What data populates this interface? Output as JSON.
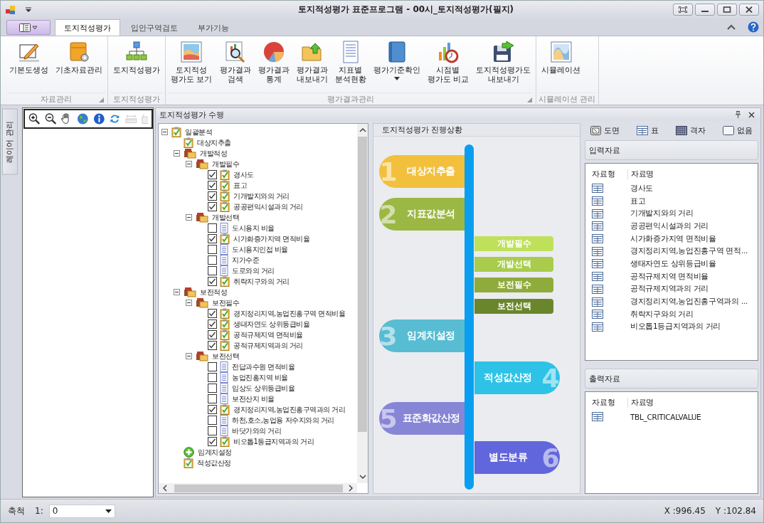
{
  "window": {
    "title": "토지적성평가 표준프로그램 - 00시_토지적성평가(필지)"
  },
  "ribbon": {
    "tabs": [
      {
        "label": "토지적성평가",
        "selected": true
      },
      {
        "label": "입안구역검토",
        "selected": false
      },
      {
        "label": "부가기능",
        "selected": false
      }
    ],
    "groups": [
      {
        "label": "자료관리",
        "launcher": true,
        "buttons": [
          {
            "label": "기본도생성",
            "dropdown": false
          },
          {
            "label": "기초자료관리",
            "dropdown": false
          }
        ]
      },
      {
        "label": "토지적성평가",
        "launcher": false,
        "buttons": [
          {
            "label": "토지적성평가",
            "dropdown": false
          }
        ]
      },
      {
        "label": "평가결과관리",
        "launcher": true,
        "buttons": [
          {
            "label": "토지적성\n평가도 보기",
            "dropdown": false
          },
          {
            "label": "평가결과\n검색",
            "dropdown": false
          },
          {
            "label": "평가결과\n통계",
            "dropdown": false
          },
          {
            "label": "평가결과\n내보내기",
            "dropdown": false
          },
          {
            "label": "지표별\n분석현황",
            "dropdown": false
          },
          {
            "label": "평가기준확인",
            "dropdown": true
          },
          {
            "label": "시점별\n평가도 비교",
            "dropdown": false
          },
          {
            "label": "토지적성평가도\n내보내기",
            "dropdown": false
          }
        ]
      },
      {
        "label": "시뮬레이션 관리",
        "launcher": false,
        "buttons": [
          {
            "label": "시뮬레이션",
            "dropdown": false
          }
        ]
      }
    ]
  },
  "layer_tab": {
    "label": "레이어 관리"
  },
  "task_panel": {
    "title": "토지적성평가 수행",
    "tree": [
      {
        "label": "일괄분석",
        "kind": "task",
        "expanded": true,
        "children": [
          {
            "label": "대상지추출",
            "kind": "task"
          },
          {
            "label": "개발적성",
            "kind": "group",
            "expanded": true,
            "children": [
              {
                "label": "개발필수",
                "kind": "group",
                "expanded": true,
                "children": [
                  {
                    "label": "경사도",
                    "kind": "indicator",
                    "checked": true
                  },
                  {
                    "label": "표고",
                    "kind": "indicator",
                    "checked": true
                  },
                  {
                    "label": "기개발지와의 거리",
                    "kind": "indicator",
                    "checked": true
                  },
                  {
                    "label": "공공편익시설과의 거리",
                    "kind": "indicator",
                    "checked": true
                  }
                ]
              },
              {
                "label": "개발선택",
                "kind": "group",
                "expanded": true,
                "children": [
                  {
                    "label": "도시용지 비율",
                    "kind": "indicator",
                    "checked": false
                  },
                  {
                    "label": "시가화증가지역 면적비율",
                    "kind": "indicator",
                    "checked": true
                  },
                  {
                    "label": "도시용지인접 비율",
                    "kind": "indicator",
                    "checked": false
                  },
                  {
                    "label": "지가수준",
                    "kind": "indicator",
                    "checked": false
                  },
                  {
                    "label": "도로와의 거리",
                    "kind": "indicator",
                    "checked": false
                  },
                  {
                    "label": "취락지구와의 거리",
                    "kind": "indicator",
                    "checked": true
                  }
                ]
              }
            ]
          },
          {
            "label": "보전적성",
            "kind": "group",
            "expanded": true,
            "children": [
              {
                "label": "보전필수",
                "kind": "group",
                "expanded": true,
                "children": [
                  {
                    "label": "경지정리지역,농업진흥구역 면적비율",
                    "kind": "indicator",
                    "checked": true
                  },
                  {
                    "label": "생태자연도 상위등급비율",
                    "kind": "indicator",
                    "checked": true
                  },
                  {
                    "label": "공적규제지역 면적비율",
                    "kind": "indicator",
                    "checked": true
                  },
                  {
                    "label": "공적규제지역과의 거리",
                    "kind": "indicator",
                    "checked": true
                  }
                ]
              },
              {
                "label": "보전선택",
                "kind": "group",
                "expanded": true,
                "children": [
                  {
                    "label": "전답과수원 면적비율",
                    "kind": "indicator",
                    "checked": false
                  },
                  {
                    "label": "농업진흥지역 비율",
                    "kind": "indicator",
                    "checked": false
                  },
                  {
                    "label": "임상도 상위등급비율",
                    "kind": "indicator",
                    "checked": false
                  },
                  {
                    "label": "보전산지 비율",
                    "kind": "indicator",
                    "checked": false
                  },
                  {
                    "label": "경지정리지역,농업진흥구역과의 거리",
                    "kind": "indicator",
                    "checked": true
                  },
                  {
                    "label": "하천,호소,농업용 저수지와의 거리",
                    "kind": "indicator",
                    "checked": false
                  },
                  {
                    "label": "바닷가와의 거리",
                    "kind": "indicator",
                    "checked": false
                  },
                  {
                    "label": "비오톱1등급지역과의 거리",
                    "kind": "indicator",
                    "checked": true
                  }
                ]
              }
            ]
          },
          {
            "label": "임계치설정",
            "kind": "pending"
          },
          {
            "label": "적성값산정",
            "kind": "task"
          }
        ]
      }
    ],
    "progress": {
      "title": "토지적성평가 진행상황",
      "steps": [
        {
          "number": "1",
          "label": "대상지추출",
          "kind": "left",
          "color": "#f2c03c"
        },
        {
          "number": "2",
          "label": "지표값분석",
          "kind": "left",
          "color": "#9bb844"
        },
        {
          "number": "3",
          "label": "임계치설정",
          "kind": "left",
          "color": "#58bcd2"
        },
        {
          "number": "4",
          "label": "적성값산정",
          "kind": "right",
          "color": "#2ec3e6"
        },
        {
          "number": "5",
          "label": "표준화값산정",
          "kind": "left",
          "color": "#8786d6"
        },
        {
          "number": "6",
          "label": "별도분류",
          "kind": "right",
          "color": "#6266dc"
        }
      ],
      "substeps": [
        {
          "label": "개발필수",
          "color": "#bfe05a"
        },
        {
          "label": "개발선택",
          "color": "#a9cc4c"
        },
        {
          "label": "보전필수",
          "color": "#8fab3c"
        },
        {
          "label": "보전선택",
          "color": "#6a862c"
        }
      ]
    },
    "data_panel": {
      "views": [
        {
          "label": "도면"
        },
        {
          "label": "표"
        },
        {
          "label": "격자"
        },
        {
          "label": "없음"
        }
      ],
      "input": {
        "title": "입력자료",
        "columns": [
          "자료형",
          "자료명"
        ],
        "rows": [
          "경사도",
          "표고",
          "기개발지와의 거리",
          "공공편익시설과의 거리",
          "시가화증가지역 면적비율",
          "경지정리지역,농업진흥구역 면적...",
          "생태자연도 상위등급비율",
          "공적규제지역 면적비율",
          "공적규제지역과의 거리",
          "경지정리지역,농업진흥구역과의 ...",
          "취락지구와의 거리",
          "비오톱1등급지역과의 거리"
        ]
      },
      "output": {
        "title": "출력자료",
        "columns": [
          "자료형",
          "자료명"
        ],
        "rows": [
          "TBL_CRITICALVALUE"
        ]
      }
    }
  },
  "status_bar": {
    "scale_label": "축척",
    "scale_prefix": "1:",
    "scale_value": "0",
    "x": "X :996.45",
    "y": "Y :102.84"
  }
}
